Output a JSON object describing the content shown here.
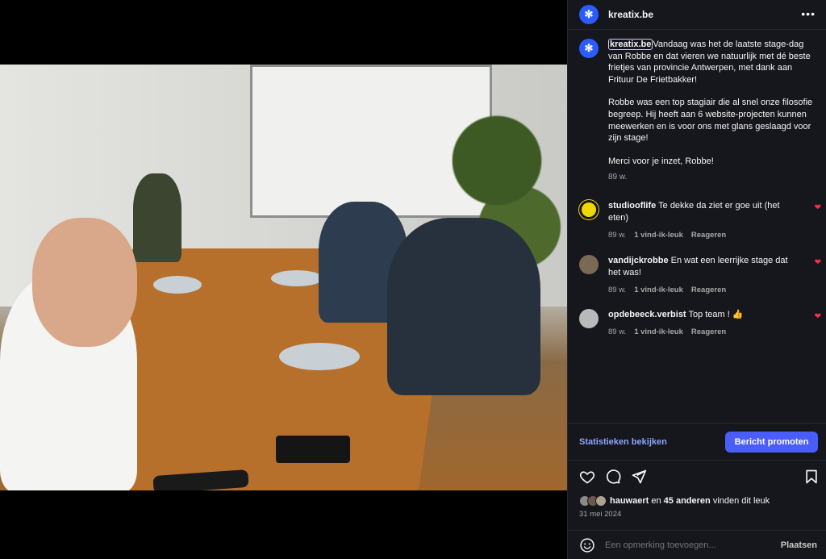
{
  "account": {
    "name": "kreatix.be",
    "avatar_glyph": "✻",
    "brand_color": "#2b5cff"
  },
  "header": {
    "more_label": "•••"
  },
  "post": {
    "tag": "kreatix.be",
    "text1": "Vandaag was het de laatste stage-dag van Robbe en dat vieren we natuurlijk met dé beste frietjes van provincie Antwerpen, met dank aan Frituur De Frietbakker!",
    "text2": "Robbe was een top stagiair die al snel onze filosofie begreep. Hij heeft aan 6 website-projecten kunnen meewerken en is voor ons met glans geslaagd voor zijn stage!",
    "text3": "Merci voor je inzet, Robbe!",
    "time": "89 w."
  },
  "comments": [
    {
      "user": "studiooflife",
      "text": "Te dekke da ziet er goe uit (het eten)",
      "time": "89 w.",
      "likes": "1 vind-ik-leuk",
      "reply": "Reageren",
      "avatar_color": "#f2d600"
    },
    {
      "user": "vandijckrobbe",
      "text": "En wat een leerrijke stage dat het was!",
      "time": "89 w.",
      "likes": "1 vind-ik-leuk",
      "reply": "Reageren",
      "avatar_color": "#7a6a55"
    },
    {
      "user": "opdebeeck.verbist",
      "text": "Top team ! 👍",
      "time": "89 w.",
      "likes": "1 vind-ik-leuk",
      "reply": "Reageren",
      "avatar_color": "#b9b9b9"
    }
  ],
  "insights": {
    "stats_label": "Statistieken bekijken",
    "promote_label": "Bericht promoten",
    "promote_color": "#4a5df9"
  },
  "likes": {
    "user": "hauwaert",
    "connector": "en",
    "others": "45 anderen",
    "suffix": "vinden dit leuk"
  },
  "date": "31 mei 2024",
  "add_comment": {
    "placeholder": "Een opmerking toevoegen...",
    "post_label": "Plaatsen"
  },
  "icons": [
    "heart-icon",
    "comment-icon",
    "share-icon",
    "bookmark-icon",
    "emoji-icon",
    "more-icon"
  ]
}
